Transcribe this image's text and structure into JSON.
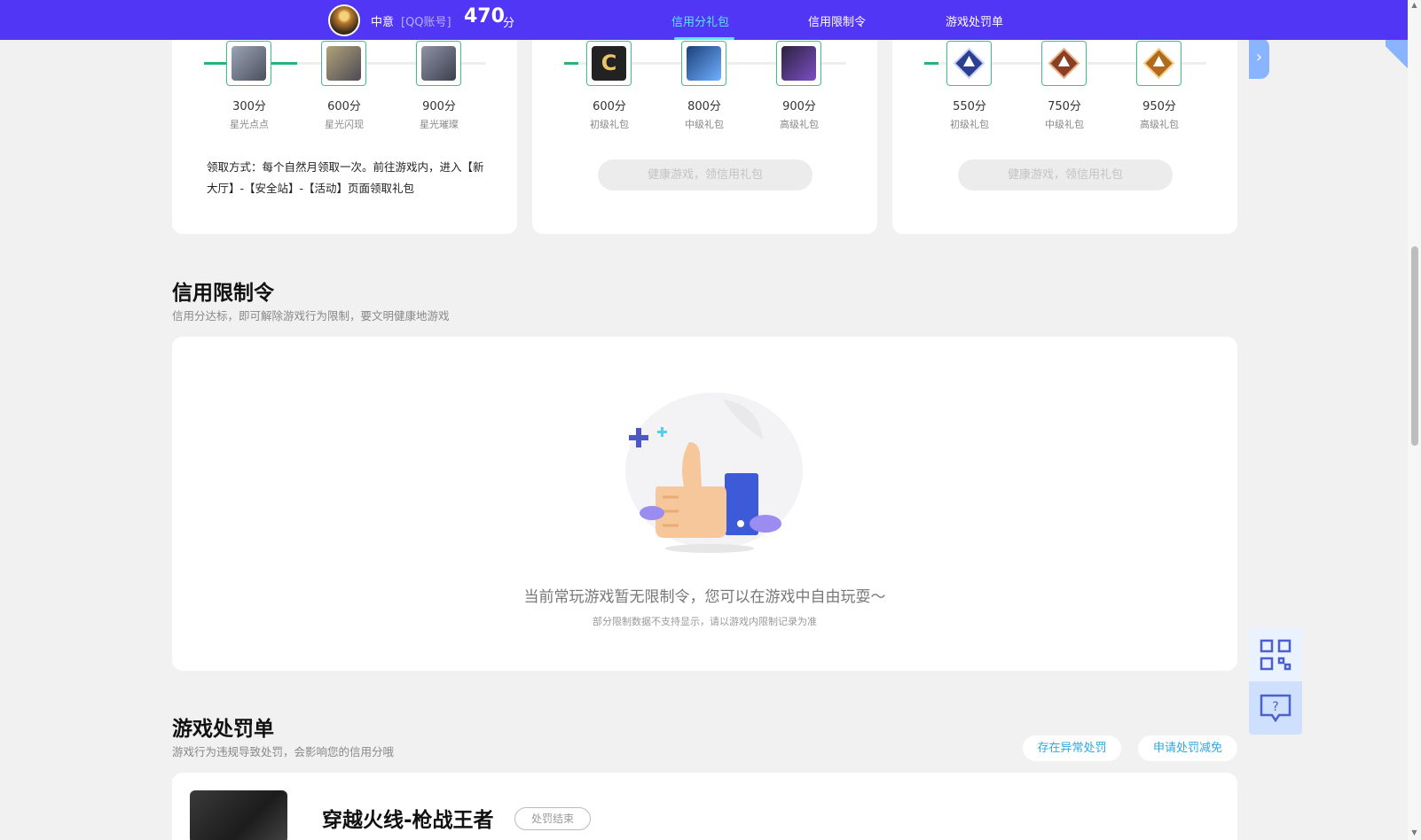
{
  "header": {
    "user_name": "中意",
    "account_type": "[QQ账号]",
    "score": "470",
    "score_unit": "分",
    "nav": [
      {
        "label": "信用分礼包",
        "active": true
      },
      {
        "label": "信用限制令",
        "active": false
      },
      {
        "label": "游戏处罚单",
        "active": false
      }
    ]
  },
  "gift_cards": [
    {
      "progress": 0.33,
      "items": [
        {
          "points": "300分",
          "name": "星光点点",
          "icon": "starlight-dot-icon"
        },
        {
          "points": "600分",
          "name": "星光闪现",
          "icon": "starlight-flash-icon"
        },
        {
          "points": "900分",
          "name": "星光璀璨",
          "icon": "starlight-brilliant-icon"
        }
      ],
      "claim_text": "领取方式：每个自然月领取一次。前往游戏内，进入【新大厅】-【安全站】-【活动】页面领取礼包"
    },
    {
      "progress": 0.05,
      "items": [
        {
          "points": "600分",
          "name": "初级礼包",
          "icon": "c-badge-icon"
        },
        {
          "points": "800分",
          "name": "中级礼包",
          "icon": "rifle-xp-icon"
        },
        {
          "points": "900分",
          "name": "高级礼包",
          "icon": "purple-chest-icon"
        }
      ],
      "button": "健康游戏，领信用礼包"
    },
    {
      "progress": 0.05,
      "items": [
        {
          "points": "550分",
          "name": "初级礼包",
          "icon": "blue-rank-icon"
        },
        {
          "points": "750分",
          "name": "中级礼包",
          "icon": "bronze-rank-icon"
        },
        {
          "points": "950分",
          "name": "高级礼包",
          "icon": "gold-rank-icon"
        }
      ],
      "button": "健康游戏，领信用礼包"
    }
  ],
  "restriction": {
    "title": "信用限制令",
    "subtitle": "信用分达标，即可解除游戏行为限制，要文明健康地游戏",
    "empty_main": "当前常玩游戏暂无限制令，您可以在游戏中自由玩耍～",
    "empty_sub": "部分限制数据不支持显示，请以游戏内限制记录为准"
  },
  "penalty": {
    "title": "游戏处罚单",
    "subtitle": "游戏行为违规导致处罚，会影响您的信用分哦",
    "btn_abnormal": "存在异常处罚",
    "btn_apply": "申请处罚减免",
    "game_title": "穿越火线-枪战王者",
    "game_status": "处罚结束"
  },
  "colors": {
    "header_bg": "#5136f5",
    "nav_active": "#5fe6ff",
    "progress": "#23b477",
    "link": "#2aa8e0"
  }
}
